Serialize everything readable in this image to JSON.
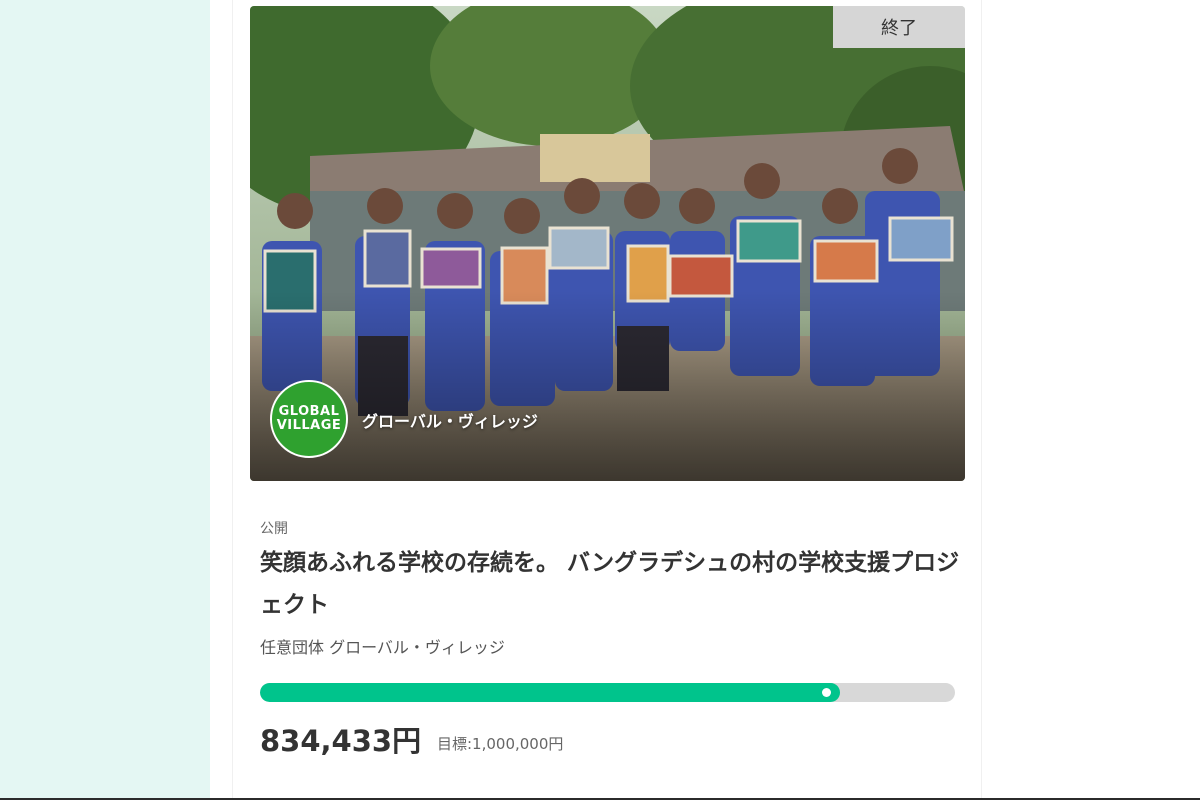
{
  "card": {
    "status_badge": "終了",
    "visibility": "公開",
    "title": "笑顔あふれる学校の存続を。 バングラデシュの村の学校支援プロジェクト",
    "org_name": "任意団体 グローバル・ヴィレッジ",
    "photo_overlay_org": "グローバル・ヴィレッジ",
    "logo_text_line1": "GLOBAL",
    "logo_text_line2": "VILLAGE",
    "amount": "834,433円",
    "goal": "目標:1,000,000円",
    "progress_fraction": 0.834
  },
  "colors": {
    "left_panel": "#e4f7f3",
    "progress_fill": "#00c48c",
    "progress_track": "#d8d8d8",
    "logo_green": "#2fa12f",
    "badge_bg": "#d6d6d6"
  }
}
